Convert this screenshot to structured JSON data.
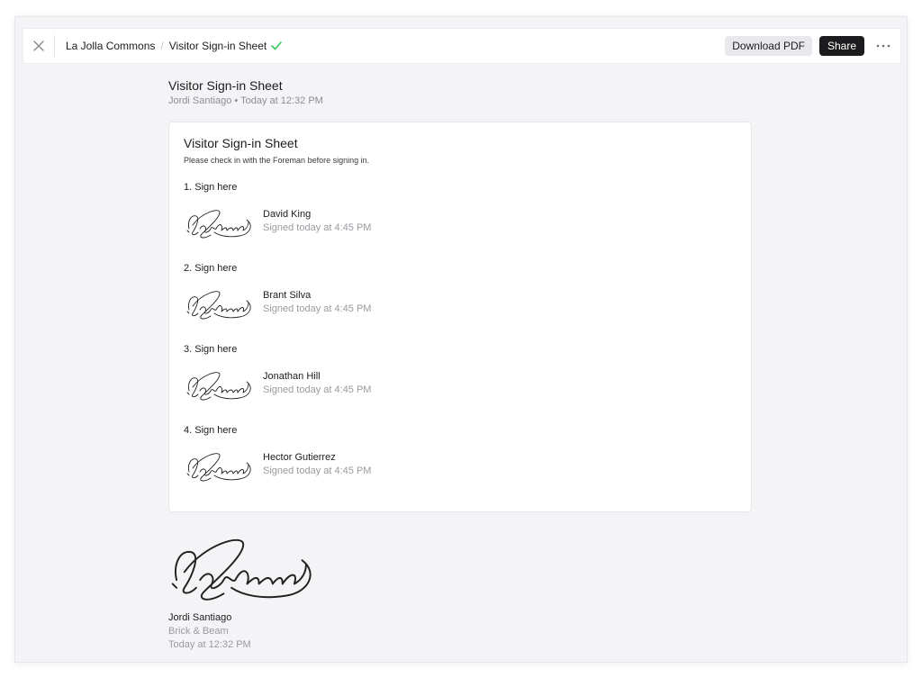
{
  "header": {
    "breadcrumb_root": "La Jolla Commons",
    "breadcrumb_separator": "/",
    "document_title": "Visitor Sign-in Sheet",
    "status_icon": "check-icon",
    "download_label": "Download PDF",
    "share_label": "Share",
    "more_icon": "ellipsis-icon",
    "close_icon": "close-icon",
    "check_color": "#34c759"
  },
  "document": {
    "title": "Visitor Sign-in Sheet",
    "author": "Jordi Santiago",
    "meta_separator": "•",
    "timestamp": "Today at 12:32 PM"
  },
  "card": {
    "title": "Visitor Sign-in Sheet",
    "instructions": "Please check in with the Foreman before signing in.",
    "entries": [
      {
        "label": "1. Sign here",
        "name": "David King",
        "status": "Signed today at 4:45 PM"
      },
      {
        "label": "2. Sign here",
        "name": "Brant Silva",
        "status": "Signed today at 4:45 PM"
      },
      {
        "label": "3. Sign here",
        "name": "Jonathan Hill",
        "status": "Signed today at 4:45 PM"
      },
      {
        "label": "4. Sign here",
        "name": "Hector Gutierrez",
        "status": "Signed today at 4:45 PM"
      }
    ]
  },
  "footer": {
    "name": "Jordi Santiago",
    "company": "Brick & Beam",
    "timestamp": "Today at 12:32 PM"
  }
}
